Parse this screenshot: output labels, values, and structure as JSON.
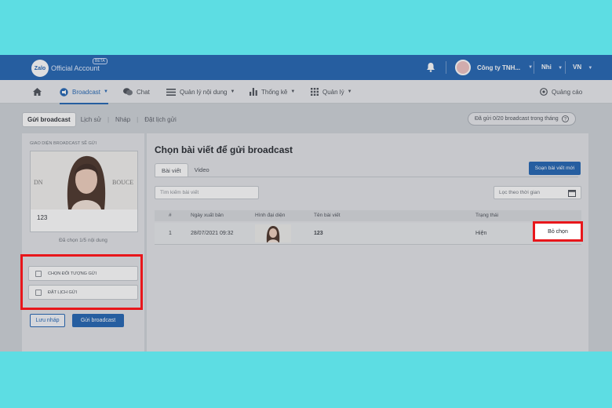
{
  "topbar": {
    "logo": "Zalo",
    "app_title": "Official Account",
    "beta": "BETA",
    "account_name": "Công ty TNH...",
    "user": "Nhi",
    "language": "VN"
  },
  "nav": {
    "items": [
      {
        "label": "Broadcast",
        "icon": "broadcast-icon"
      },
      {
        "label": "Chat",
        "icon": "chat-icon"
      },
      {
        "label": "Quản lý nội dung",
        "icon": "list-icon"
      },
      {
        "label": "Thống kê",
        "icon": "bar-chart-icon"
      },
      {
        "label": "Quản lý",
        "icon": "grid-icon"
      }
    ],
    "ads": "Quảng cáo"
  },
  "subtabs": [
    "Gửi broadcast",
    "Lịch sử",
    "Nháp",
    "Đặt lịch gửi"
  ],
  "quota": "Đã gửi 0/20 broadcast trong tháng",
  "left_panel": {
    "title": "GIAO DIỆN BROADCAST SẼ GỬI",
    "preview_caption": "123",
    "preview_logo_left": "DN",
    "preview_logo_right": "BOUCE",
    "selected_count": "Đã chọn 1/5 nội dung",
    "options": [
      "CHỌN ĐỐI TƯỢNG GỬI",
      "ĐẶT LỊCH GỬI"
    ],
    "save_draft": "Lưu nháp",
    "send": "Gửi broadcast"
  },
  "main_panel": {
    "title": "Chọn bài viết để gửi broadcast",
    "tabs": [
      "Bài viết",
      "Video"
    ],
    "compose": "Soạn bài viết mới",
    "search_placeholder": "Tìm kiếm bài viết",
    "date_filter": "Lọc theo thời gian",
    "columns": [
      "#",
      "Ngày xuất bản",
      "Hình đại diện",
      "Tên bài viết",
      "Trạng thái"
    ],
    "rows": [
      {
        "index": "1",
        "date": "28/07/2021 09:32",
        "title": "123",
        "status": "Hiện",
        "action": "Bỏ chọn"
      }
    ]
  },
  "colors": {
    "brand": "#1f63b3",
    "highlight": "#e8161b",
    "background": "#5ddde3"
  }
}
